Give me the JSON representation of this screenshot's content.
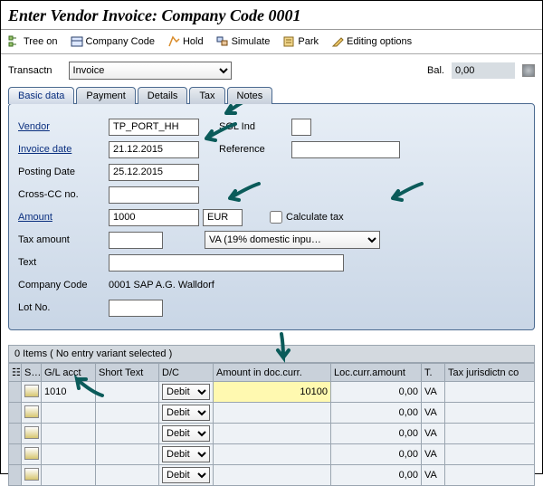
{
  "title": "Enter Vendor Invoice: Company Code 0001",
  "toolbar": {
    "tree_on": "Tree on",
    "company_code": "Company Code",
    "hold": "Hold",
    "simulate": "Simulate",
    "park": "Park",
    "editing_options": "Editing options"
  },
  "transactn_label": "Transactn",
  "transactn_value": "Invoice",
  "bal_label": "Bal.",
  "bal_value": "0,00",
  "tabs": {
    "basic_data": "Basic data",
    "payment": "Payment",
    "details": "Details",
    "tax": "Tax",
    "notes": "Notes"
  },
  "form": {
    "vendor_label": "Vendor",
    "vendor_value": "TP_PORT_HH",
    "sgl_ind_label": "SGL Ind",
    "sgl_ind_value": "",
    "invoice_date_label": "Invoice date",
    "invoice_date_value": "21.12.2015",
    "reference_label": "Reference",
    "reference_value": "",
    "posting_date_label": "Posting Date",
    "posting_date_value": "25.12.2015",
    "cross_cc_label": "Cross-CC no.",
    "cross_cc_value": "",
    "amount_label": "Amount",
    "amount_value": "1000",
    "currency_value": "EUR",
    "calc_tax_label": "Calculate tax",
    "tax_amount_label": "Tax amount",
    "tax_amount_value": "",
    "tax_code_value": "VA (19% domestic inpu…",
    "text_label": "Text",
    "text_value": "",
    "company_code_label": "Company Code",
    "company_code_value": "0001 SAP A.G. Walldorf",
    "lot_no_label": "Lot No.",
    "lot_no_value": ""
  },
  "grid": {
    "header": "0 Items ( No entry variant selected )",
    "cols": {
      "status": "S…",
      "gl_acct": "G/L acct",
      "short_text": "Short Text",
      "dc": "D/C",
      "amt_doc": "Amount in doc.curr.",
      "loc_amt": "Loc.curr.amount",
      "tax": "T.",
      "tax_jur": "Tax jurisdictn co"
    },
    "rows": [
      {
        "gl": "1010",
        "short": "",
        "dc": "Debit",
        "amt_doc": "10100",
        "loc": "0,00",
        "tax": "VA"
      },
      {
        "gl": "",
        "short": "",
        "dc": "Debit",
        "amt_doc": "",
        "loc": "0,00",
        "tax": "VA"
      },
      {
        "gl": "",
        "short": "",
        "dc": "Debit",
        "amt_doc": "",
        "loc": "0,00",
        "tax": "VA"
      },
      {
        "gl": "",
        "short": "",
        "dc": "Debit",
        "amt_doc": "",
        "loc": "0,00",
        "tax": "VA"
      },
      {
        "gl": "",
        "short": "",
        "dc": "Debit",
        "amt_doc": "",
        "loc": "0,00",
        "tax": "VA"
      }
    ]
  }
}
